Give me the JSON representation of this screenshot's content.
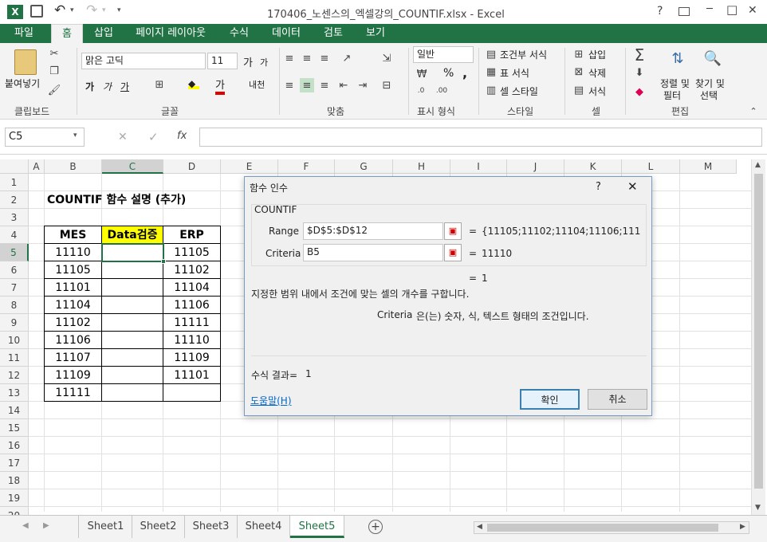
{
  "window": {
    "title": "170406_노센스의_엑셀강의_COUNTIF.xlsx - Excel",
    "help": "?",
    "min": "─",
    "max": "□",
    "close": "✕"
  },
  "qat": {
    "excel_logo": "X",
    "save": "💾",
    "undo": "↶",
    "redo": "↷"
  },
  "tabs": [
    {
      "label": "파일"
    },
    {
      "label": "홈"
    },
    {
      "label": "삽입"
    },
    {
      "label": "페이지 레이아웃"
    },
    {
      "label": "수식"
    },
    {
      "label": "데이터"
    },
    {
      "label": "검토"
    },
    {
      "label": "보기"
    }
  ],
  "ribbon": {
    "clipboard": {
      "paste": "붙여넣기",
      "group": "클립보드"
    },
    "font": {
      "name": "맑은 고딕",
      "size": "11",
      "grow": "가",
      "shrink": "가",
      "bold": "가",
      "italic": "가",
      "underline": "가",
      "group": "글꼴",
      "phonetic": "내천"
    },
    "align": {
      "group": "맞춤"
    },
    "number": {
      "format": "일반",
      "percent": "%",
      "comma": ",",
      "group": "표시 형식"
    },
    "styles": {
      "conditional": "조건부 서식",
      "table": "표 서식",
      "cell": "셀 스타일",
      "group": "스타일"
    },
    "cells": {
      "insert": "삽입",
      "delete": "삭제",
      "format": "서식",
      "group": "셀"
    },
    "editing": {
      "sort": "정렬 및",
      "sort2": "필터",
      "find": "찾기 및",
      "find2": "선택",
      "group": "편집"
    }
  },
  "formula_bar": {
    "name_box": "C5",
    "cancel": "✕",
    "enter": "✓",
    "fx": "fx",
    "content": ""
  },
  "columns": [
    "A",
    "B",
    "C",
    "D",
    "E",
    "F",
    "G",
    "H",
    "I",
    "J",
    "K",
    "L",
    "M"
  ],
  "rows": [
    "1",
    "2",
    "3",
    "4",
    "5",
    "6",
    "7",
    "8",
    "9",
    "10",
    "11",
    "12",
    "13",
    "14",
    "15",
    "16",
    "17",
    "18",
    "19",
    "20"
  ],
  "sheet": {
    "title": "COUNTIF 함수 설명 (추가)",
    "headers": [
      "MES",
      "Data검증",
      "ERP"
    ],
    "mes": [
      "11110",
      "11105",
      "11101",
      "11104",
      "11102",
      "11106",
      "11107",
      "11109",
      "11111"
    ],
    "erp": [
      "11105",
      "11102",
      "11104",
      "11106",
      "11111",
      "11110",
      "11109",
      "11101",
      ""
    ]
  },
  "dialog": {
    "title": "함수 인수",
    "help": "?",
    "close": "✕",
    "function": "COUNTIF",
    "range_label": "Range",
    "range_value": "$D$5:$D$12",
    "range_result": "{11105;11102;11104;11106;11111;1",
    "criteria_label": "Criteria",
    "criteria_value": "B5",
    "criteria_result": "11110",
    "eq": "=",
    "result": "1",
    "description": "지정한 범위 내에서 조건에 맞는 셀의 개수를 구합니다.",
    "arg_name": "Criteria",
    "arg_desc": "은(는) 숫자, 식, 텍스트 형태의 조건입니다.",
    "formula_result_label": "수식 결과=",
    "formula_result": "1",
    "help_link": "도움말(H)",
    "ok": "확인",
    "cancel": "취소"
  },
  "sheets": [
    "Sheet1",
    "Sheet2",
    "Sheet3",
    "Sheet4",
    "Sheet5"
  ],
  "colors": {
    "accent": "#217346",
    "highlight": "#ffff00",
    "selection": "#217346"
  }
}
